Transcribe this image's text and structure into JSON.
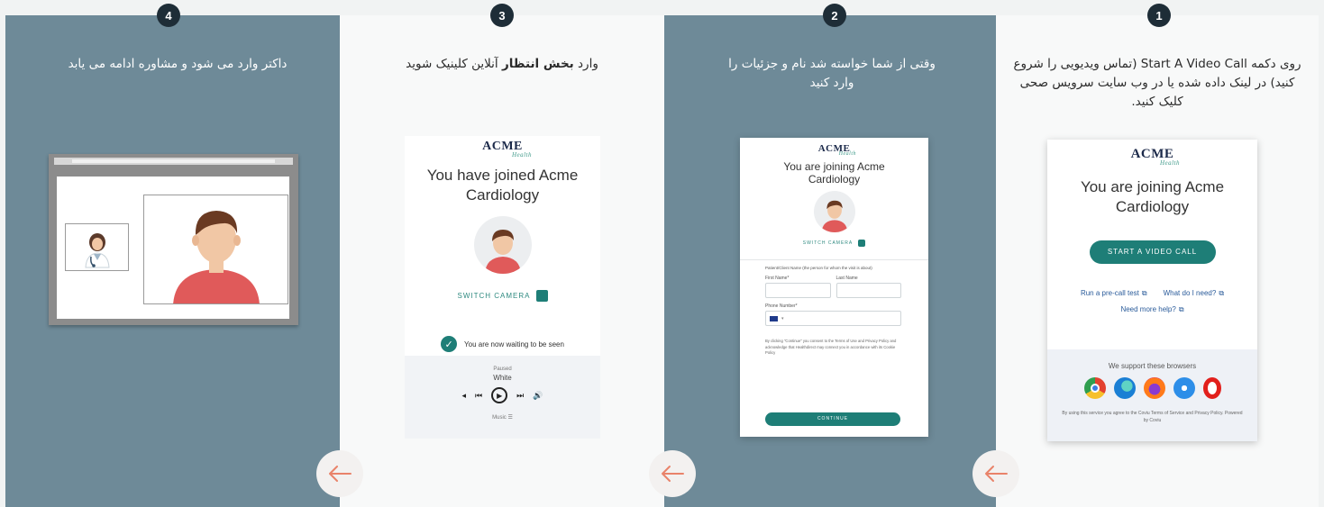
{
  "steps": [
    {
      "number": "1",
      "text_parts": [
        "روی دکمه Start A Video Call (تماس ویدیویی را شروع کنید) در لینک داده شده یا در وب سایت سرویس صحی کلیک کنید."
      ],
      "card": {
        "logo": "ACME",
        "logo_sub": "Health",
        "heading": "You are joining Acme Cardiology",
        "button": "START A VIDEO CALL",
        "link_precall": "Run a pre-call test",
        "link_need": "What do I need?",
        "link_help": "Need more help?",
        "browsers_text": "We support these browsers",
        "terms_text": "By using this service you agree to the Coviu Terms of Service and Privacy Policy. Powered by Coviu"
      }
    },
    {
      "number": "2",
      "text": "وقتی از شما خواسته شد نام و جزئیات را وارد کنید",
      "card": {
        "logo": "ACME",
        "logo_sub": "Health",
        "heading": "You are joining Acme Cardiology",
        "switch_camera": "SWITCH CAMERA",
        "form_intro": "Patient/Client Name (the person for whom the visit is about)",
        "first_name": "First Name*",
        "last_name": "Last Name",
        "phone": "Phone Number*",
        "privacy_note": "By clicking \"Continue\" you consent to the Terms of Use and Privacy Policy and acknowledge that Healthdirect may connect you in accordance with its Cookie Policy",
        "continue": "CONTINUE"
      }
    },
    {
      "number": "3",
      "text_before": "وارد ",
      "text_bold": "بخش انتظار",
      "text_after": " آنلاین کلینیک شوید",
      "card": {
        "logo": "ACME",
        "logo_sub": "Health",
        "heading": "You have joined Acme Cardiology",
        "switch_camera": "SWITCH CAMERA",
        "waiting": "You are now waiting to be seen",
        "paused": "Paused",
        "track": "White",
        "music": "Music"
      }
    },
    {
      "number": "4",
      "text": "داکتر وارد می شود و مشاوره ادامه می یابد"
    }
  ],
  "colors": {
    "panel_dark": "#6e8a98",
    "panel_light": "#f8f9f9",
    "badge": "#1e2d37",
    "accent_teal": "#1e7e77",
    "arrow": "#e9836a"
  }
}
